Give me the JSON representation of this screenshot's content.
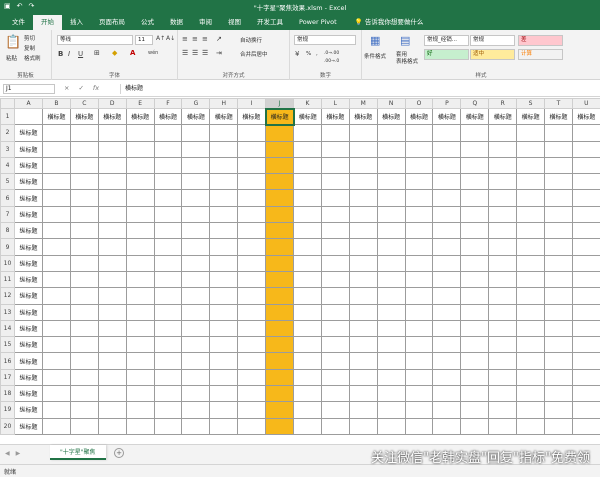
{
  "window": {
    "title": "\"十字星\"聚焦效果.xlsm  -  Excel"
  },
  "qat": {
    "save_icon": "save-icon",
    "undo_icon": "undo-icon",
    "redo_icon": "redo-icon"
  },
  "ribbon_tabs": [
    "文件",
    "开始",
    "插入",
    "页面布局",
    "公式",
    "数据",
    "审阅",
    "视图",
    "开发工具",
    "Power Pivot"
  ],
  "active_tab": "开始",
  "tell_me": "告诉我你想要做什么",
  "ribbon": {
    "clipboard": {
      "label": "剪贴板",
      "paste": "粘贴",
      "cut": "剪切",
      "copy": "复制",
      "format_painter": "格式刷"
    },
    "font": {
      "label": "字体",
      "font_name": "等线",
      "font_size": "11",
      "bold": "B",
      "italic": "I",
      "underline": "U",
      "font_color": "A",
      "wen": "wén"
    },
    "alignment": {
      "label": "对齐方式",
      "wrap": "自动换行",
      "merge": "合并后居中"
    },
    "number": {
      "label": "数字",
      "format": "常规",
      "percent": "%",
      "comma": ",",
      "inc": ".0→.00",
      "dec": ".00→.0"
    },
    "styles": {
      "label": "样式",
      "conditional": "条件格式",
      "table_format": "套用\n表格格式",
      "cells": [
        {
          "text": "常规_经销...",
          "bg": "#ffffff",
          "fg": "#222222"
        },
        {
          "text": "常规",
          "bg": "#ffffff",
          "fg": "#222222"
        },
        {
          "text": "差",
          "bg": "#ffc7ce",
          "fg": "#9c0006"
        },
        {
          "text": "好",
          "bg": "#c6efce",
          "fg": "#006100"
        },
        {
          "text": "适中",
          "bg": "#ffeb9c",
          "fg": "#9c5700"
        },
        {
          "text": "计算",
          "bg": "#f2f2f2",
          "fg": "#fa7d00"
        }
      ]
    }
  },
  "formula_bar": {
    "name_box": "J1",
    "cancel": "×",
    "enter": "✓",
    "fx": "fx",
    "content": "横标题"
  },
  "columns": [
    "A",
    "B",
    "C",
    "D",
    "E",
    "F",
    "G",
    "H",
    "I",
    "J",
    "K",
    "L",
    "M",
    "N",
    "O",
    "P",
    "Q",
    "R",
    "S",
    "T",
    "U"
  ],
  "column_header_text": "横标题",
  "row_header_text": "纵标题",
  "row_count": 21,
  "selected_column": "J",
  "active_cell": "J1",
  "highlight_color": "#f7b81a",
  "sheet": {
    "name": "\"十字星\"聚焦",
    "add_label": "+",
    "nav_first": "◀",
    "nav_last": "▶"
  },
  "status": {
    "ready": "就绪"
  },
  "watermark": "关注微信\"老韩实盘\"回复\"指标\"免费领"
}
